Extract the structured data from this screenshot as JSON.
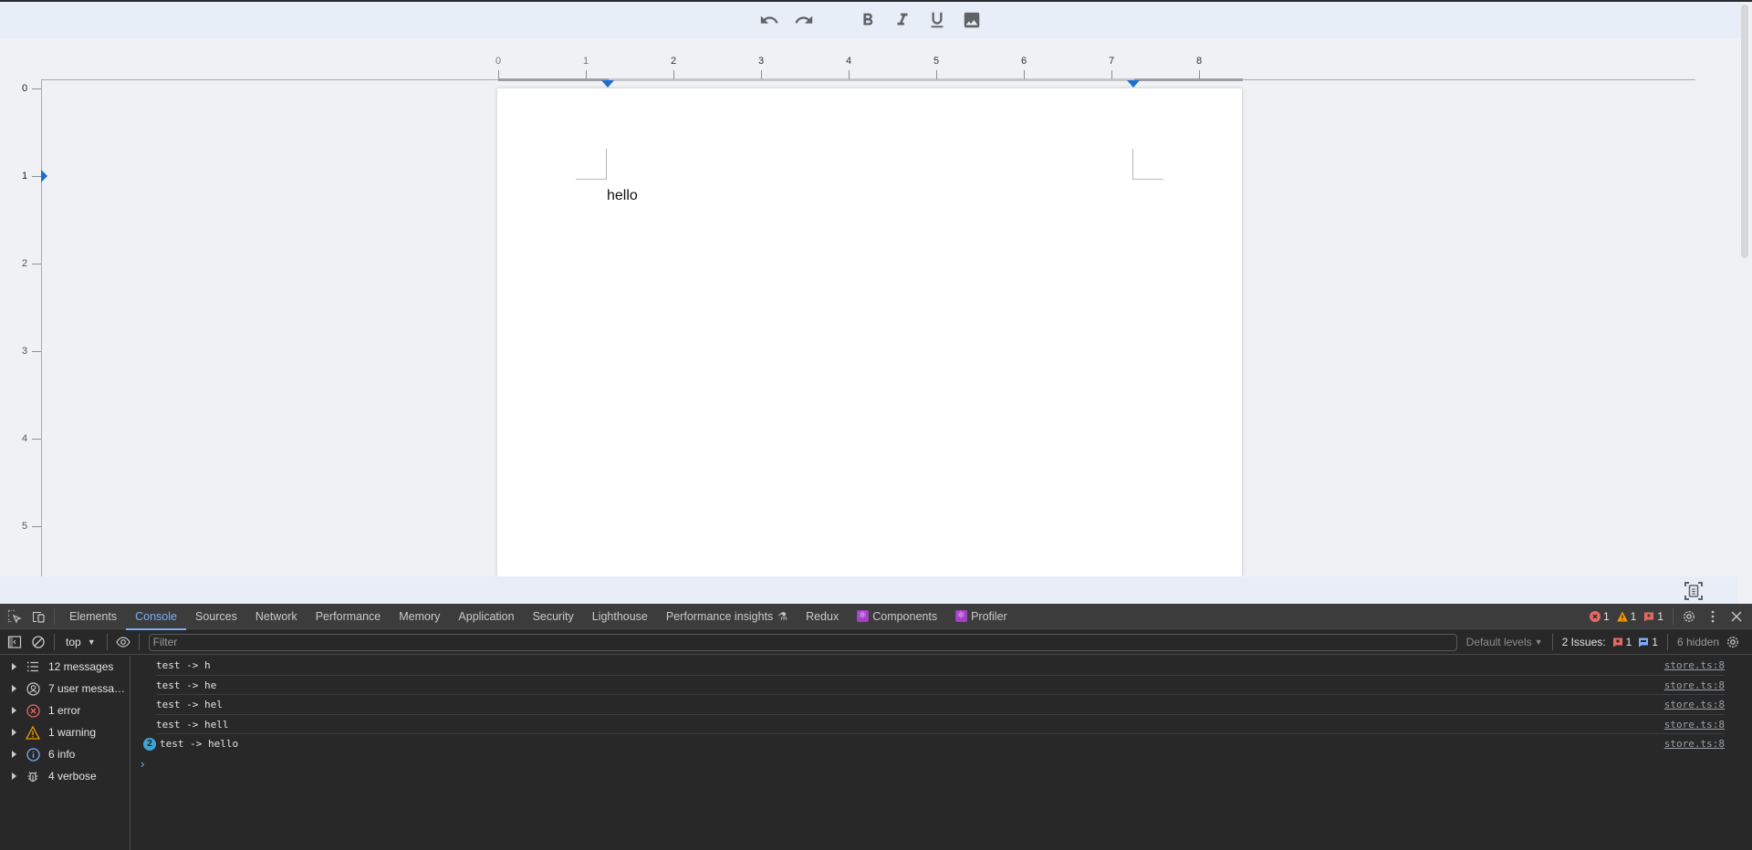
{
  "toolbar": {
    "buttons": [
      {
        "name": "undo",
        "icon": "undo-icon",
        "label": "Undo"
      },
      {
        "name": "redo",
        "icon": "redo-icon",
        "label": "Redo"
      },
      {
        "name": "bold",
        "icon": "bold-icon",
        "label": "Bold"
      },
      {
        "name": "italic",
        "icon": "italic-icon",
        "label": "Italic"
      },
      {
        "name": "underline",
        "icon": "underline-icon",
        "label": "Underline"
      },
      {
        "name": "image",
        "icon": "image-icon",
        "label": "Insert image"
      }
    ]
  },
  "ruler": {
    "horizontal_labels": [
      "0",
      "1",
      "2",
      "3",
      "4",
      "5",
      "6",
      "7",
      "8"
    ],
    "vertical_labels": [
      "0",
      "1",
      "2",
      "3",
      "4",
      "5"
    ],
    "left_indent_inches": 1.25,
    "right_indent_inches": 7.25,
    "top_margin_inches": 1,
    "accent_color": "#1a6fd1"
  },
  "document": {
    "text": "hello"
  },
  "statusbar": {
    "fit_icon": "fit-page-icon"
  },
  "devtools": {
    "tabs": [
      {
        "label": "Elements",
        "active": false
      },
      {
        "label": "Console",
        "active": true
      },
      {
        "label": "Sources",
        "active": false
      },
      {
        "label": "Network",
        "active": false
      },
      {
        "label": "Performance",
        "active": false
      },
      {
        "label": "Memory",
        "active": false
      },
      {
        "label": "Application",
        "active": false
      },
      {
        "label": "Security",
        "active": false
      },
      {
        "label": "Lighthouse",
        "active": false
      },
      {
        "label": "Performance insights",
        "active": false,
        "experimental": true
      },
      {
        "label": "Redux",
        "active": false
      },
      {
        "label": "Components",
        "active": false,
        "react": true
      },
      {
        "label": "Profiler",
        "active": false,
        "react": true
      }
    ],
    "counts": {
      "errors": "1",
      "warnings": "1",
      "issues": "1"
    },
    "filterbar": {
      "context": "top",
      "filter_placeholder": "Filter",
      "filter_value": "",
      "levels": "Default levels",
      "issues_label": "2 Issues:",
      "issues_errors": "1",
      "issues_info": "1",
      "hidden": "6 hidden"
    },
    "sidebar": [
      {
        "label": "12 messages",
        "icon": "list-icon"
      },
      {
        "label": "7 user messa…",
        "icon": "user-icon"
      },
      {
        "label": "1 error",
        "icon": "error-icon"
      },
      {
        "label": "1 warning",
        "icon": "warning-icon"
      },
      {
        "label": "6 info",
        "icon": "info-icon"
      },
      {
        "label": "4 verbose",
        "icon": "bug-icon"
      }
    ],
    "logs": [
      {
        "text": "test -> h",
        "source": "store.ts:8",
        "repeat": null
      },
      {
        "text": "test -> he",
        "source": "store.ts:8",
        "repeat": null
      },
      {
        "text": "test -> hel",
        "source": "store.ts:8",
        "repeat": null
      },
      {
        "text": "test -> hell",
        "source": "store.ts:8",
        "repeat": null
      },
      {
        "text": "test -> hello",
        "source": "store.ts:8",
        "repeat": "2"
      }
    ],
    "prompt": "›",
    "colors": {
      "active_tab": "#7cacf8",
      "error": "#e46962",
      "warning": "#f29900",
      "info": "#7cacf8",
      "repeat_badge": "#3fa4d4",
      "react": "#a53fc4"
    }
  }
}
